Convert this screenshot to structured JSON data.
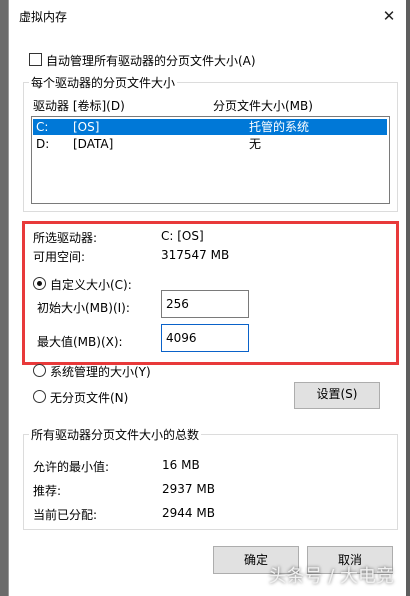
{
  "window": {
    "title": "虚拟内存",
    "close_glyph": "✕"
  },
  "auto_manage": {
    "label": "自动管理所有驱动器的分页文件大小(A)",
    "checked": false
  },
  "drives_group": {
    "legend": "每个驱动器的分页文件大小",
    "col_drive": "驱动器 [卷标](D)",
    "col_size": "分页文件大小(MB)",
    "rows": [
      {
        "letter": "C:",
        "label": "[OS]",
        "size": "托管的系统",
        "selected": true
      },
      {
        "letter": "D:",
        "label": "[DATA]",
        "size": "无",
        "selected": false
      }
    ]
  },
  "selected_drive": {
    "drive_label": "所选驱动器:",
    "drive_value": "C:  [OS]",
    "space_label": "可用空间:",
    "space_value": "317547 MB"
  },
  "options": {
    "custom": "自定义大小(C):",
    "initial_label": "初始大小(MB)(I):",
    "initial_value": "256",
    "max_label": "最大值(MB)(X):",
    "max_value": "4096",
    "system_managed": "系统管理的大小(Y)",
    "no_paging": "无分页文件(N)",
    "set_button": "设置(S)"
  },
  "totals_group": {
    "legend": "所有驱动器分页文件大小的总数",
    "min_label": "允许的最小值:",
    "min_value": "16 MB",
    "recommended_label": "推荐:",
    "recommended_value": "2937 MB",
    "current_label": "当前已分配:",
    "current_value": "2944 MB"
  },
  "buttons": {
    "ok": "确定",
    "cancel": "取消"
  },
  "watermark": "头条号 / 大电竞",
  "colors": {
    "selection": "#0078d7",
    "highlight": "#e8393a"
  }
}
